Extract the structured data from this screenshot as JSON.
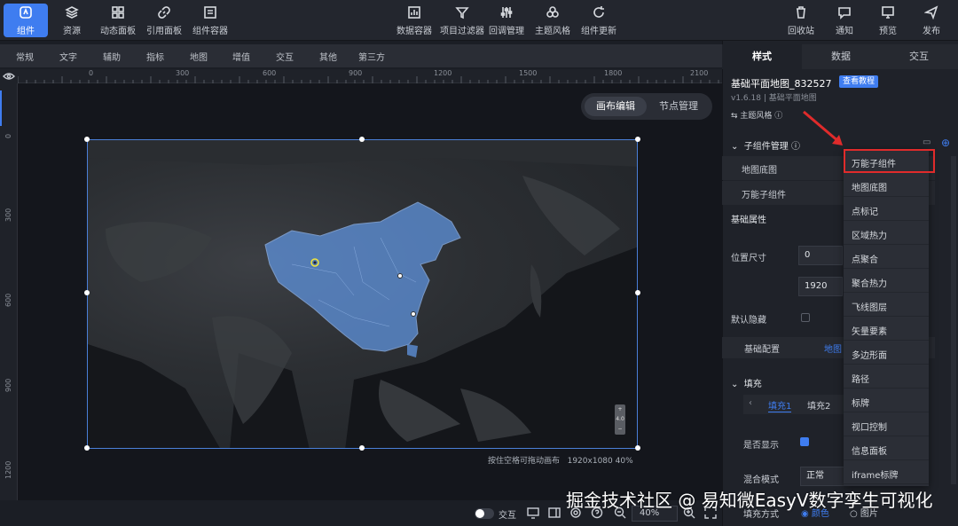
{
  "toolbar": {
    "left": [
      {
        "label": "组件",
        "icon": "component-icon"
      },
      {
        "label": "资源",
        "icon": "layers-icon"
      },
      {
        "label": "动态面板",
        "icon": "grid-icon"
      },
      {
        "label": "引用面板",
        "icon": "link-icon"
      },
      {
        "label": "组件容器",
        "icon": "container-icon"
      }
    ],
    "center": [
      {
        "label": "数据容器",
        "icon": "chart-icon"
      },
      {
        "label": "项目过滤器",
        "icon": "filter-icon"
      },
      {
        "label": "回调管理",
        "icon": "sliders-icon"
      },
      {
        "label": "主题风格",
        "icon": "palette-icon"
      },
      {
        "label": "组件更新",
        "icon": "refresh-icon"
      }
    ],
    "right": [
      {
        "label": "回收站",
        "icon": "trash-icon"
      },
      {
        "label": "通知",
        "icon": "message-icon"
      },
      {
        "label": "预览",
        "icon": "monitor-icon"
      },
      {
        "label": "发布",
        "icon": "send-icon"
      }
    ]
  },
  "categories": [
    "常规",
    "文字",
    "辅助",
    "指标",
    "地图",
    "增值",
    "交互",
    "其他",
    "第三方"
  ],
  "ruler": {
    "h_ticks": [
      "0",
      "300",
      "600",
      "900",
      "1200",
      "1500",
      "1800",
      "2100"
    ],
    "v_ticks": [
      "0",
      "300",
      "600",
      "900",
      "1200"
    ]
  },
  "canvas": {
    "toggle": [
      "画布编辑",
      "节点管理"
    ],
    "hint": "按住空格可拖动画布",
    "size": "1920x1080",
    "scale": "40%"
  },
  "bottom": {
    "interact_label": "交互",
    "zoom": "40%"
  },
  "panel": {
    "tabs": [
      "样式",
      "数据",
      "交互"
    ],
    "component_title": "基础平面地图_832527",
    "tutorial": "查看教程",
    "version": "v1.6.18 | 基础平面地图",
    "theme_style": "主题风格",
    "sub_manage": "子组件管理",
    "sub_items": [
      "地图底图",
      "万能子组件"
    ],
    "basic_props": "基础属性",
    "position_size": "位置尺寸",
    "pos_x": "0",
    "width": "1920",
    "default_hidden": "默认隐藏",
    "subtabs": [
      "基础配置",
      "地图"
    ],
    "fill_section": "填充",
    "fill_tabs": [
      "填充1",
      "填充2"
    ],
    "show_label": "是否显示",
    "blend_label": "混合模式",
    "blend_value": "正常",
    "fill_mode_label": "填充方式",
    "fill_mode_opts": [
      "颜色",
      "图片"
    ]
  },
  "dropdown": [
    "万能子组件",
    "地图底图",
    "点标记",
    "区域热力",
    "点聚合",
    "聚合热力",
    "飞线图层",
    "矢量要素",
    "多边形面",
    "路径",
    "标牌",
    "视口控制",
    "信息面板",
    "iframe标牌"
  ],
  "watermark": "掘金技术社区 @ 易知微EasyV数字孪生可视化",
  "colors": {
    "accent": "#3f7df0",
    "highlight": "#e02b2b"
  }
}
